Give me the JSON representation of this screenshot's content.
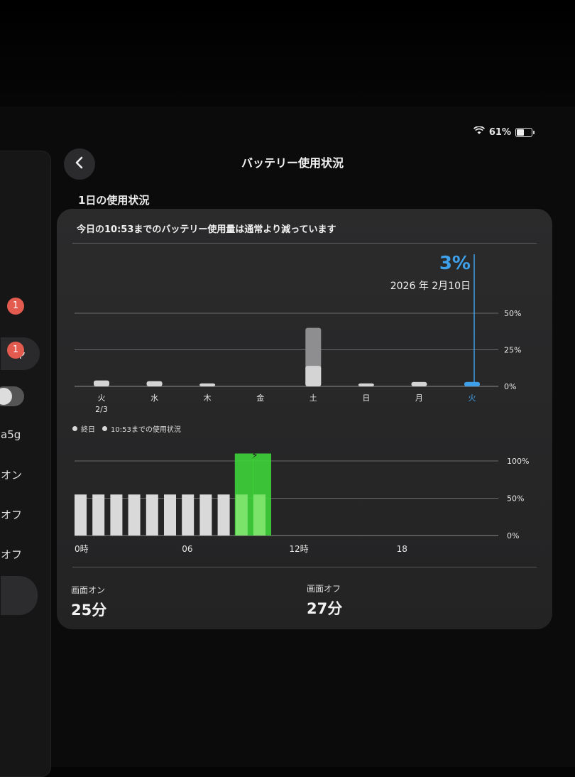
{
  "status_bar": {
    "battery_percent": "61%",
    "battery_level": 0.61
  },
  "header": {
    "title": "バッテリー使用状況"
  },
  "section": {
    "title": "1日の使用状況"
  },
  "sidebar": {
    "badges": [
      "1",
      "1"
    ],
    "texts": [
      "a5g",
      "オン",
      "オフ",
      "オフ"
    ]
  },
  "card": {
    "headline": "今日の10:53までのバッテリー使用量は通常より減っています",
    "selected": {
      "value": "3%",
      "date": "2026 年 2月10日"
    }
  },
  "legend": {
    "items": [
      "終日",
      "10:53までの使用状況"
    ]
  },
  "stats": [
    {
      "label": "画面オン",
      "value": "25分"
    },
    {
      "label": "画面オフ",
      "value": "27分"
    }
  ],
  "chart_data": [
    {
      "type": "bar",
      "categories": [
        "火",
        "水",
        "木",
        "金",
        "土",
        "日",
        "月",
        "火"
      ],
      "sublabels": [
        "2/3",
        "",
        "",
        "",
        "",
        "",
        "",
        ""
      ],
      "series": [
        {
          "name": "終日",
          "values": [
            4,
            3.5,
            2,
            0,
            40,
            2,
            3,
            3
          ]
        },
        {
          "name": "10:53までの使用状況",
          "values": [
            4,
            3.5,
            2,
            0,
            14,
            2,
            3,
            3
          ]
        }
      ],
      "selected_index": 7,
      "ylim": [
        0,
        60
      ],
      "yticks": [
        "0%",
        "25%",
        "50%"
      ],
      "ytick_values": [
        0,
        25,
        50
      ]
    },
    {
      "type": "bar",
      "xticks": [
        "0時",
        "06",
        "12時",
        "18"
      ],
      "xtick_hours": [
        0,
        6,
        12,
        18
      ],
      "hours": [
        0,
        1,
        2,
        3,
        4,
        5,
        6,
        7,
        8,
        9,
        10
      ],
      "values": [
        55,
        55,
        55,
        55,
        55,
        55,
        55,
        55,
        55,
        55,
        55
      ],
      "charging": [
        false,
        false,
        false,
        false,
        false,
        false,
        false,
        false,
        false,
        true,
        true
      ],
      "charge_level": [
        0,
        0,
        0,
        0,
        0,
        0,
        0,
        0,
        0,
        110,
        110
      ],
      "ylim": [
        0,
        110
      ],
      "yticks": [
        "0%",
        "50%",
        "100%"
      ],
      "ytick_values": [
        0,
        50,
        100
      ],
      "colors": {
        "bar": "#d9d9d9",
        "charge": "#3fd43a"
      }
    }
  ]
}
